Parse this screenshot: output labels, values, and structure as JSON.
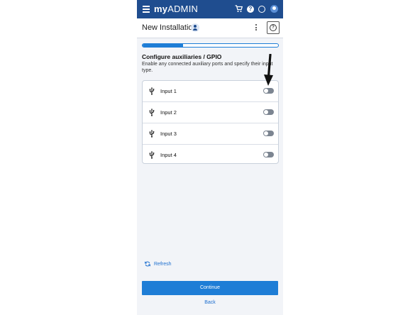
{
  "app": {
    "logo_my": "my",
    "logo_admin": "ADMIN"
  },
  "topbar": {
    "icons": [
      "menu-icon",
      "cart-icon",
      "help-icon",
      "globe-icon",
      "account-icon"
    ]
  },
  "header": {
    "title": "New Installation",
    "help_glyph": "?"
  },
  "progress": {
    "value": 0.3
  },
  "section": {
    "title": "Configure auxiliaries / GPIO",
    "description": "Enable any connected auxiliary ports and specify their input type."
  },
  "inputs": [
    {
      "label": "Input 1",
      "enabled": false
    },
    {
      "label": "Input 2",
      "enabled": false
    },
    {
      "label": "Input 3",
      "enabled": false
    },
    {
      "label": "Input 4",
      "enabled": false
    }
  ],
  "actions": {
    "refresh": "Refresh",
    "continue": "Continue",
    "back": "Back"
  },
  "colors": {
    "topbar": "#1f4d8f",
    "accent": "#1e7dd6",
    "link": "#1e6fcf",
    "toggle_off": "#7c8591"
  }
}
